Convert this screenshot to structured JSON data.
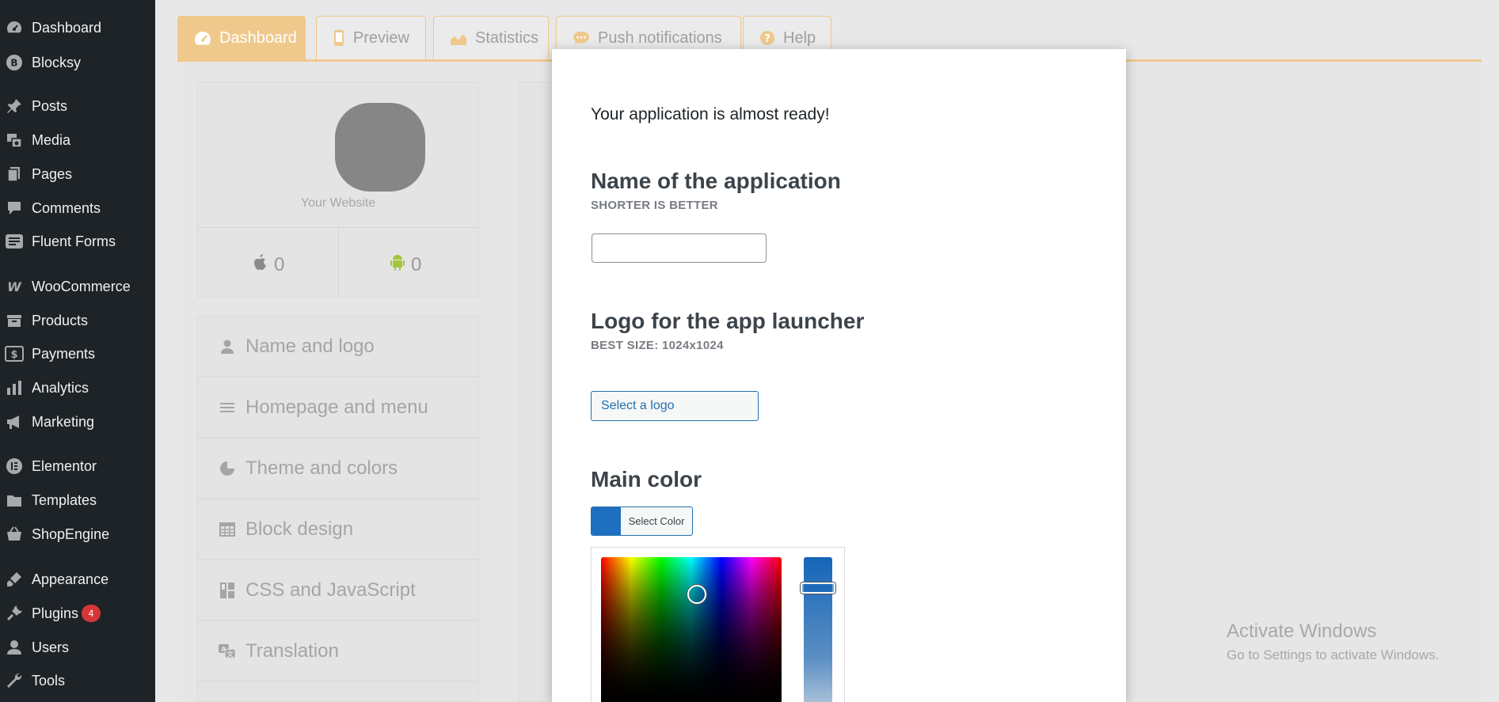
{
  "sidebar": {
    "items": [
      {
        "label": "Dashboard",
        "icon": "dashboard-icon"
      },
      {
        "label": "Blocksy",
        "icon": "blocksy-icon"
      },
      {
        "label": "Posts",
        "icon": "pin-icon"
      },
      {
        "label": "Media",
        "icon": "media-icon"
      },
      {
        "label": "Pages",
        "icon": "pages-icon"
      },
      {
        "label": "Comments",
        "icon": "comment-icon"
      },
      {
        "label": "Fluent Forms",
        "icon": "forms-icon"
      },
      {
        "label": "WooCommerce",
        "icon": "woocommerce-icon"
      },
      {
        "label": "Products",
        "icon": "archive-icon"
      },
      {
        "label": "Payments",
        "icon": "dollar-icon"
      },
      {
        "label": "Analytics",
        "icon": "bar-chart-icon"
      },
      {
        "label": "Marketing",
        "icon": "megaphone-icon"
      },
      {
        "label": "Elementor",
        "icon": "elementor-icon"
      },
      {
        "label": "Templates",
        "icon": "folder-icon"
      },
      {
        "label": "ShopEngine",
        "icon": "basket-icon"
      },
      {
        "label": "Appearance",
        "icon": "brush-icon"
      },
      {
        "label": "Plugins",
        "icon": "plug-icon",
        "badge": "4"
      },
      {
        "label": "Users",
        "icon": "user-icon"
      },
      {
        "label": "Tools",
        "icon": "wrench-icon"
      }
    ]
  },
  "tabs": [
    {
      "label": "Dashboard",
      "icon": "gauge-icon",
      "active": true
    },
    {
      "label": "Preview",
      "icon": "mobile-icon",
      "active": false
    },
    {
      "label": "Statistics",
      "icon": "area-chart-icon",
      "active": false
    },
    {
      "label": "Push notifications",
      "icon": "chat-bubble-icon",
      "active": false
    },
    {
      "label": "Help",
      "icon": "question-circle-icon",
      "active": false
    }
  ],
  "profile": {
    "site_name": "Your Website",
    "ios_count": "0",
    "android_count": "0"
  },
  "nav": [
    {
      "label": "Name and logo",
      "icon": "user-icon"
    },
    {
      "label": "Homepage and menu",
      "icon": "menu-lines-icon"
    },
    {
      "label": "Theme and colors",
      "icon": "palette-icon"
    },
    {
      "label": "Block design",
      "icon": "table-grid-icon"
    },
    {
      "label": "CSS and JavaScript",
      "icon": "layout-icon"
    },
    {
      "label": "Translation",
      "icon": "translate-icon"
    }
  ],
  "modal": {
    "ready_text": "Your application is almost ready!",
    "name_title": "Name of the application",
    "name_sub": "SHORTER IS BETTER",
    "name_value": "",
    "logo_title": "Logo for the app launcher",
    "logo_sub": "BEST SIZE: 1024x1024",
    "logo_button": "Select a logo",
    "color_title": "Main color",
    "color_button": "Select Color",
    "color_value": "#1e6fc0"
  },
  "watermark": {
    "title": "Activate Windows",
    "sub": "Go to Settings to activate Windows."
  },
  "colors": {
    "accent": "#efc98c",
    "wp_blue": "#2271b1",
    "sidebar_bg": "#1d2327",
    "badge_red": "#d63638"
  }
}
